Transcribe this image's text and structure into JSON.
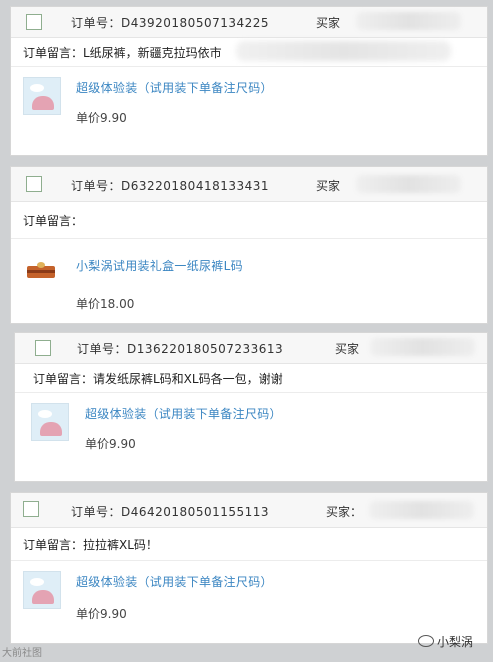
{
  "orders": [
    {
      "order_label": "订单号：D43920180507134225",
      "buyer_label": "买家",
      "note": "订单留言：L纸尿裤，新疆克拉玛依市",
      "product_name": "超级体验装（试用装下单备注尺码）",
      "price": "单价9.90",
      "thumbnail_icon": "baby-dress-image"
    },
    {
      "order_label": "订单号：D63220180418133431",
      "buyer_label": "买家",
      "note": "订单留言：",
      "product_name": "小梨涡试用装礼盒一纸尿裤L码",
      "price": "单价18.00",
      "thumbnail_icon": "gift-box-image"
    },
    {
      "order_label": "订单号：D136220180507233613",
      "buyer_label": "买家",
      "note": "订单留言：请发纸尿裤L码和XL码各一包，谢谢",
      "product_name": "超级体验装（试用装下单备注尺码）",
      "price": "单价9.90",
      "thumbnail_icon": "baby-dress-image"
    },
    {
      "order_label": "订单号：D46420180501155113",
      "buyer_label": "买家：",
      "note": "订单留言：拉拉裤XL码！",
      "product_name": "超级体验装（试用装下单备注尺码）",
      "price": "单价9.90",
      "thumbnail_icon": "baby-dress-image"
    }
  ],
  "watermark": {
    "right_text": "小梨涡",
    "left_text": "大前社图"
  },
  "colors": {
    "product_link": "#3b86c2",
    "checkbox_border": "#8fae8f",
    "background": "#cfd1d3"
  }
}
